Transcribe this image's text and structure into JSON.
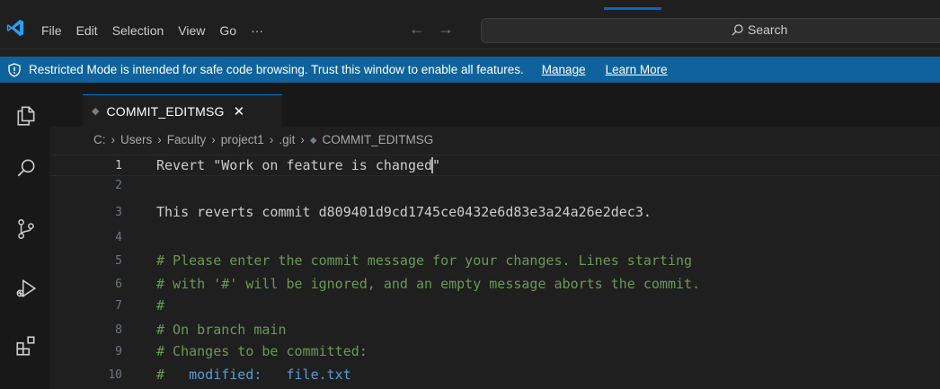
{
  "menu": [
    "File",
    "Edit",
    "Selection",
    "View",
    "Go",
    "···"
  ],
  "nav": {
    "back": "←",
    "forward": "→"
  },
  "search": {
    "label": "Search"
  },
  "banner": {
    "text": "Restricted Mode is intended for safe code browsing. Trust this window to enable all features.",
    "manage": "Manage",
    "learn_more": "Learn More"
  },
  "tab": {
    "label": "COMMIT_EDITMSG",
    "close": "✕"
  },
  "breadcrumb": [
    "C:",
    "Users",
    "Faculty",
    "project1",
    ".git",
    "COMMIT_EDITMSG"
  ],
  "editor": {
    "lines": [
      {
        "n": "1",
        "text": "Revert \"Work on feature is changed\""
      },
      {
        "n": "2",
        "text": ""
      },
      {
        "n": "3",
        "text": "This reverts commit d809401d9cd1745ce0432e6d83e3a24a26e2dec3."
      },
      {
        "n": "4",
        "text": ""
      },
      {
        "n": "5",
        "text": "# Please enter the commit message for your changes. Lines starting"
      },
      {
        "n": "6",
        "text": "# with '#' will be ignored, and an empty message aborts the commit."
      },
      {
        "n": "7",
        "text": "#"
      },
      {
        "n": "8",
        "text": "# On branch main"
      },
      {
        "n": "9",
        "text": "# Changes to be committed:"
      },
      {
        "n": "10",
        "text": "#   modified:   file.txt"
      }
    ],
    "line1_before_cursor": "Revert \"Work on feature is changed",
    "line1_after_cursor": "\"",
    "line10_prefix": "#   ",
    "line10_keyword": "modified:   file.txt"
  },
  "colors": {
    "banner": "#0e639c",
    "accent": "#0078d4",
    "comment": "#6a9955",
    "keyword": "#569cd6"
  }
}
